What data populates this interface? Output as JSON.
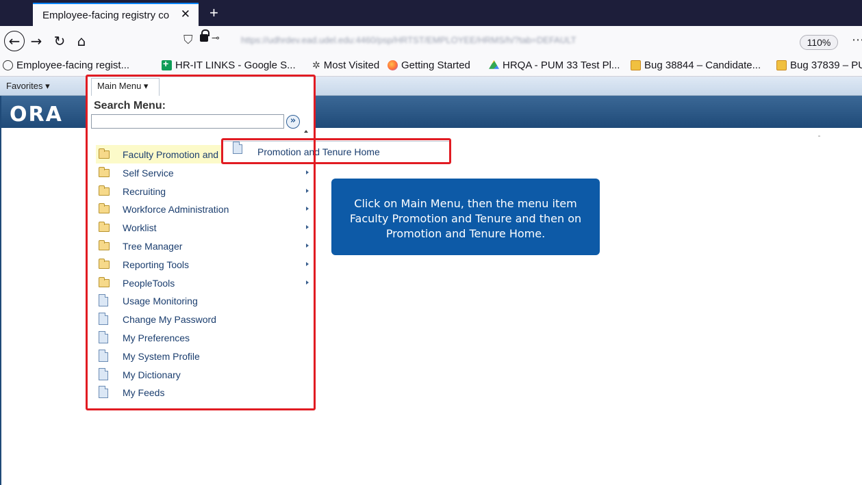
{
  "browser": {
    "tab_title": "Employee-facing registry co",
    "tab_close": "✕",
    "new_tab": "+",
    "nav": {
      "back": "←",
      "forward": "→",
      "reload": "↻",
      "home": "⌂"
    },
    "url": "https://udhrdev.ead.udel.edu:4460/psp/HRTST/EMPLOYEE/HRMS/h/?tab=DEFAULT",
    "zoom": "110%",
    "overflow": "⋯",
    "bookmarks": [
      {
        "label": "Employee-facing regist...",
        "icon": "globe-icon"
      },
      {
        "label": "HR-IT LINKS - Google S...",
        "icon": "sheets-icon"
      },
      {
        "label": "Most Visited",
        "icon": "gear-icon"
      },
      {
        "label": "Getting Started",
        "icon": "firefox-icon"
      },
      {
        "label": "HRQA - PUM 33 Test Pl...",
        "icon": "drive-icon"
      },
      {
        "label": "Bug 38844 – Candidate...",
        "icon": "bug-icon"
      },
      {
        "label": "Bug 37839 – PU",
        "icon": "bug-icon"
      }
    ]
  },
  "ps": {
    "favorites": "Favorites ▾",
    "main_menu": "Main Menu ▾",
    "logo": "ORA",
    "search_title": "Search Menu:",
    "search_value": "",
    "search_go": "»",
    "menu_items": [
      {
        "label": "Faculty Promotion and",
        "icon": "folder-icon",
        "arrow": false
      },
      {
        "label": "Self Service",
        "icon": "folder-icon",
        "arrow": true
      },
      {
        "label": "Recruiting",
        "icon": "folder-icon",
        "arrow": true
      },
      {
        "label": "Workforce Administration",
        "icon": "folder-icon",
        "arrow": true
      },
      {
        "label": "Worklist",
        "icon": "folder-icon",
        "arrow": true
      },
      {
        "label": "Tree Manager",
        "icon": "folder-icon",
        "arrow": true
      },
      {
        "label": "Reporting Tools",
        "icon": "folder-icon",
        "arrow": true
      },
      {
        "label": "PeopleTools",
        "icon": "folder-icon",
        "arrow": true
      },
      {
        "label": "Usage Monitoring",
        "icon": "document-icon",
        "arrow": false
      },
      {
        "label": "Change My Password",
        "icon": "document-icon",
        "arrow": false
      },
      {
        "label": "My Preferences",
        "icon": "document-icon",
        "arrow": false
      },
      {
        "label": "My System Profile",
        "icon": "document-icon",
        "arrow": false
      },
      {
        "label": "My Dictionary",
        "icon": "document-icon",
        "arrow": false
      },
      {
        "label": "My Feeds",
        "icon": "document-icon",
        "arrow": false
      }
    ],
    "submenu_item": "Promotion and Tenure Home"
  },
  "callout": {
    "text": "Click on Main Menu, then the menu item Faculty Promotion and Tenure and then on Promotion and Tenure Home."
  },
  "colors": {
    "annotation_red": "#e11b22",
    "callout_blue": "#0d5aa7",
    "banner_blue": "#2a5685",
    "highlight_yellow": "#fcfac9"
  }
}
